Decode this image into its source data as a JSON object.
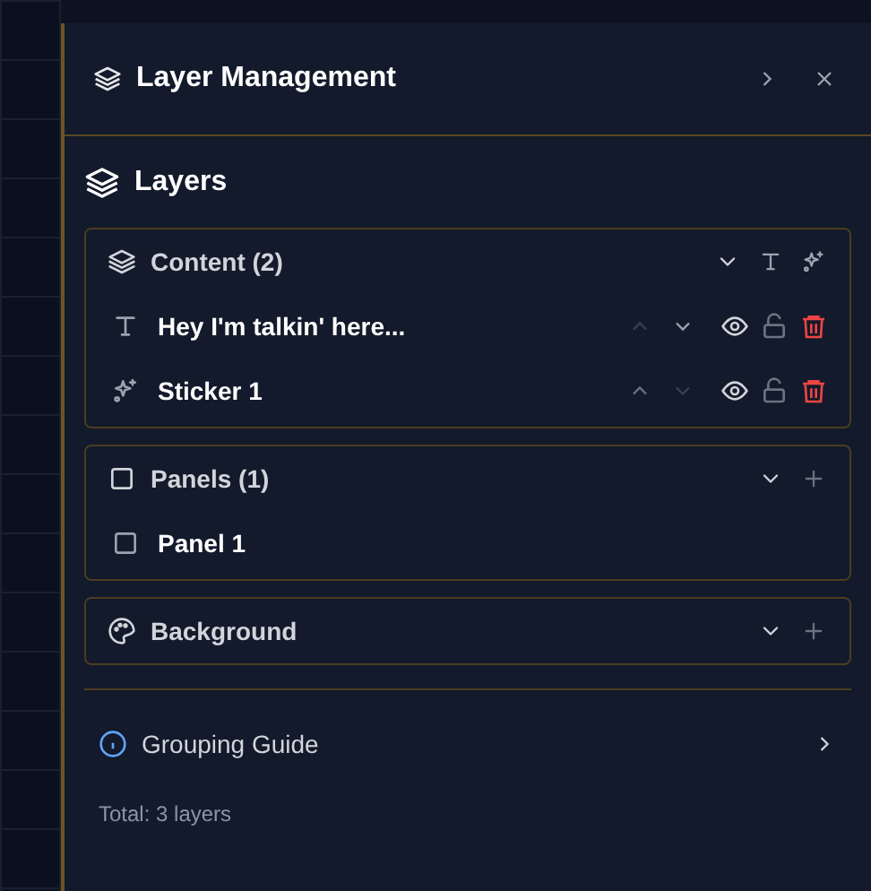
{
  "panel": {
    "title": "Layer Management"
  },
  "section_title": "Layers",
  "groups": [
    {
      "kind": "content",
      "label": "Content (2)",
      "actions": [
        {
          "kind": "collapse"
        },
        {
          "kind": "add_text"
        },
        {
          "kind": "add_sticker"
        }
      ],
      "items": [
        {
          "kind": "text",
          "label": "Hey I'm talkin' here...",
          "can_move_up": false,
          "can_move_down": true
        },
        {
          "kind": "sticker",
          "label": "Sticker 1",
          "can_move_up": true,
          "can_move_down": false
        }
      ]
    },
    {
      "kind": "panels",
      "label": "Panels (1)",
      "actions": [
        {
          "kind": "collapse"
        },
        {
          "kind": "add"
        }
      ],
      "items": [
        {
          "kind": "panel",
          "label": "Panel 1"
        }
      ]
    },
    {
      "kind": "background",
      "label": "Background",
      "actions": [
        {
          "kind": "collapse"
        },
        {
          "kind": "add"
        }
      ]
    }
  ],
  "guide": {
    "label": "Grouping Guide"
  },
  "total": "Total: 3 layers"
}
